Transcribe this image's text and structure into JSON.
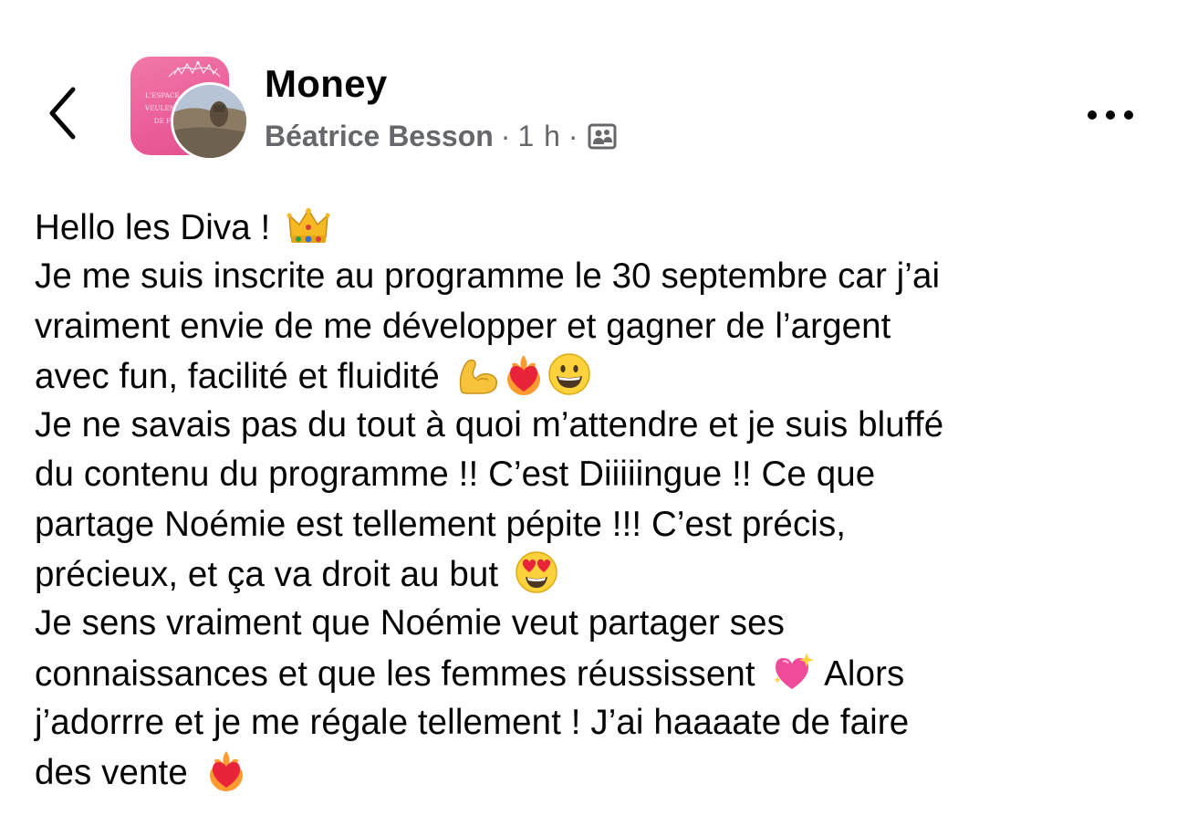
{
  "header": {
    "group_name": "Money",
    "author": "Béatrice Besson",
    "separator": "·",
    "time": "1 h",
    "group_avatar_text": [
      "L'ESPACE",
      "VEULENT",
      "DE F"
    ]
  },
  "icons": {
    "back": "chevron-left-icon",
    "more": "more-horizontal-icon",
    "audience": "group-audience-icon"
  },
  "post": {
    "lines": [
      {
        "text": "Hello les Diva ! ",
        "emojis": [
          "crown"
        ]
      },
      {
        "text": "Je me suis inscrite au programme le 30 septembre car j’ai",
        "emojis": []
      },
      {
        "text": "vraiment envie de me développer et gagner de l’argent",
        "emojis": []
      },
      {
        "text": "avec fun, facilité et fluidité ",
        "emojis": [
          "flexed-biceps",
          "heart-on-fire",
          "grinning-face"
        ]
      },
      {
        "text": "Je ne savais pas du tout à quoi m’attendre et je suis bluffé",
        "emojis": []
      },
      {
        "text": "du contenu du programme !! C’est Diiiiingue !! Ce que",
        "emojis": []
      },
      {
        "text": "partage Noémie est tellement pépite !!! C’est précis,",
        "emojis": []
      },
      {
        "text": "précieux, et ça va droit au but ",
        "emojis": [
          "heart-eyes"
        ]
      },
      {
        "text": "Je sens vraiment que Noémie veut partager ses",
        "emojis": []
      },
      {
        "text": "connaissances et que les femmes réussissent ",
        "emojis": [
          "sparkling-heart"
        ],
        "after": " Alors"
      },
      {
        "text": "j’adorrre et je me régale tellement ! J’ai haaaate de faire",
        "emojis": []
      },
      {
        "text": "des vente ",
        "emojis": [
          "heart-on-fire"
        ]
      }
    ]
  },
  "colors": {
    "text": "#050505",
    "meta": "#65676b",
    "group_pink": "#ec5f9a"
  }
}
